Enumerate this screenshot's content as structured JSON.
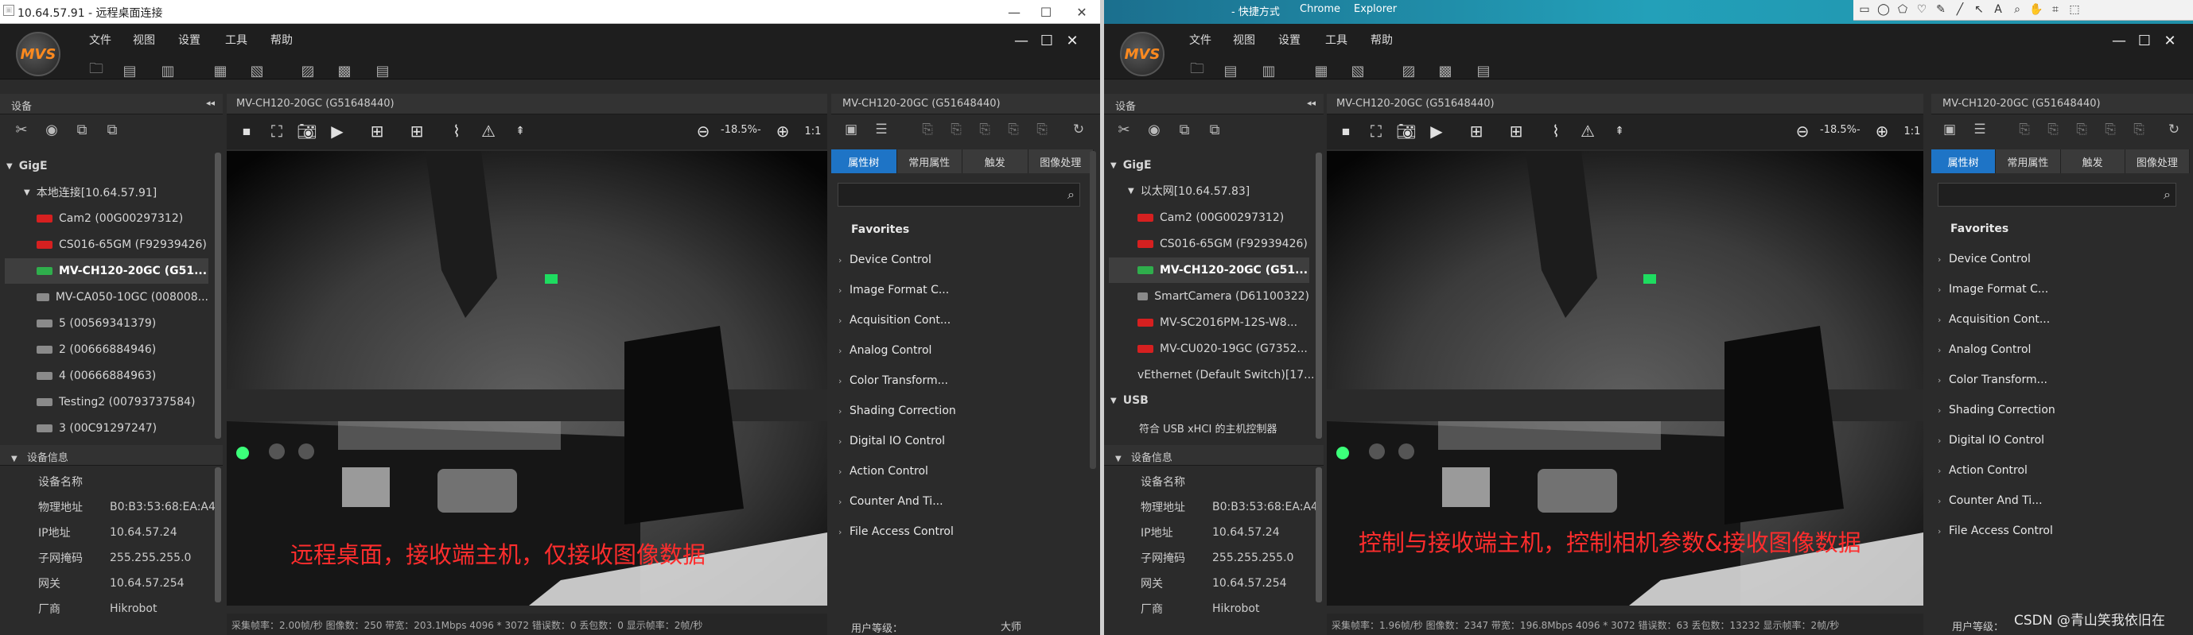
{
  "left": {
    "rdp_title": "10.64.57.91 - 远程桌面连接",
    "menu": [
      "文件",
      "视图",
      "设置",
      "工具",
      "帮助"
    ],
    "logo_text": "MVS",
    "devices_title": "设备",
    "gige_label": "GigE",
    "network_label": "本地连接[10.64.57.91]",
    "devices": [
      {
        "label": "Cam2 (00G00297312)",
        "color": "red"
      },
      {
        "label": "CS016-65GM (F92939426)",
        "color": "red"
      },
      {
        "label": "MV-CH120-20GC (G51...",
        "color": "green",
        "selected": true
      },
      {
        "label": "MV-CA050-10GC (008008...",
        "color": "grey"
      },
      {
        "label": "5 (00569341379)",
        "color": "grey"
      },
      {
        "label": "2 (00666884946)",
        "color": "grey"
      },
      {
        "label": "4 (00666884963)",
        "color": "grey"
      },
      {
        "label": "Testing2 (00793737584)",
        "color": "grey"
      },
      {
        "label": "3 (00C91297247)",
        "color": "grey"
      }
    ],
    "info_title": "设备信息",
    "info": [
      {
        "k": "设备名称",
        "v": ""
      },
      {
        "k": "物理地址",
        "v": "B0:B3:53:68:EA:A4"
      },
      {
        "k": "IP地址",
        "v": "10.64.57.24"
      },
      {
        "k": "子网掩码",
        "v": "255.255.255.0"
      },
      {
        "k": "网关",
        "v": "10.64.57.254"
      },
      {
        "k": "厂商",
        "v": "Hikrobot"
      }
    ],
    "view_title": "MV-CH120-20GC (G51648440)",
    "zoom": "-18.5%-",
    "status": "采集帧率：2.00帧/秒  图像数：250  带宽：203.1Mbps  4096 * 3072  错误数：0  丢包数：0  显示帧率：2帧/秒",
    "caption": "远程桌面，接收端主机，仅接收图像数据",
    "user_level_label": "用户等级：",
    "user_level_value": "大师"
  },
  "right": {
    "menu": [
      "文件",
      "视图",
      "设置",
      "工具",
      "帮助"
    ],
    "logo_text": "MVS",
    "devices_title": "设备",
    "gige_label": "GigE",
    "network_label": "以太网[10.64.57.83]",
    "devices": [
      {
        "label": "Cam2 (00G00297312)",
        "color": "red"
      },
      {
        "label": "CS016-65GM (F92939426)",
        "color": "red"
      },
      {
        "label": "MV-CH120-20GC (G51...",
        "color": "green",
        "selected": true
      },
      {
        "label": "SmartCamera (D61100322)",
        "color": "grey"
      },
      {
        "label": "MV-SC2016PM-12S-W8...",
        "color": "red"
      },
      {
        "label": "MV-CU020-19GC (G7352...",
        "color": "red"
      },
      {
        "label": "vEthernet (Default Switch)[17...",
        "color": "none"
      }
    ],
    "usb_label": "USB",
    "usb_item": "符合 USB xHCI 的主机控制器",
    "info_title": "设备信息",
    "info": [
      {
        "k": "设备名称",
        "v": ""
      },
      {
        "k": "物理地址",
        "v": "B0:B3:53:68:EA:A4"
      },
      {
        "k": "IP地址",
        "v": "10.64.57.24"
      },
      {
        "k": "子网掩码",
        "v": "255.255.255.0"
      },
      {
        "k": "网关",
        "v": "10.64.57.254"
      },
      {
        "k": "厂商",
        "v": "Hikrobot"
      }
    ],
    "view_title": "MV-CH120-20GC (G51648440)",
    "zoom": "-18.5%-",
    "status": "采集帧率：1.96帧/秒  图像数：2347  带宽：196.8Mbps  4096 * 3072  错误数：63  丢包数：13232  显示帧率：2帧/秒",
    "caption": "控制与接收端主机，控制相机参数&接收图像数据",
    "user_level_label": "用户等级："
  },
  "props": {
    "tabs": [
      "属性树",
      "常用属性",
      "触发",
      "图像处理"
    ],
    "favorites": "Favorites",
    "items": [
      "Device Control",
      "Image Format C...",
      "Acquisition Cont...",
      "Analog Control",
      "Color Transform...",
      "Shading Correction",
      "Digital IO Control",
      "Action Control",
      "Counter And Ti...",
      "File Access Control"
    ]
  },
  "taskbar": {
    "shortcut": "- 快捷方式",
    "chrome": "Chrome",
    "explorer": "Explorer"
  },
  "watermark": "CSDN @青山笑我依旧在",
  "accent_color": "#1e74c6",
  "caption_color": "#ff2d2d"
}
